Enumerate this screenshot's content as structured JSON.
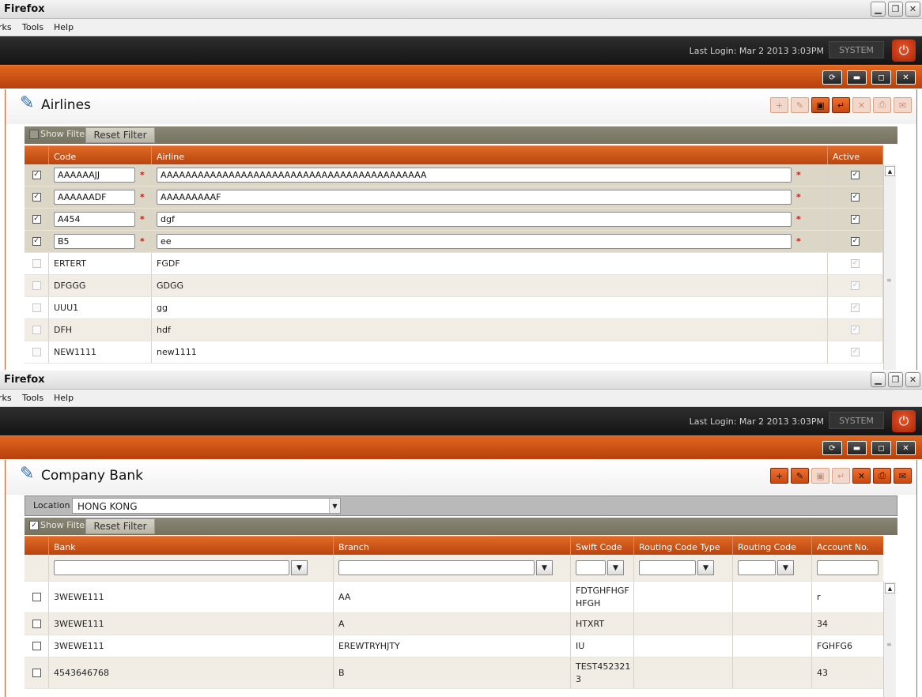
{
  "top_window": {
    "titlebar": {
      "title": "Firefox"
    },
    "menu": {
      "item1": "rks",
      "item2": "Tools",
      "item3": "Help"
    },
    "appbar": {
      "last_login": "Last Login: Mar 2 2013 3:03PM",
      "user": "SYSTEM"
    },
    "page_title": "Airlines",
    "filter": {
      "show_filter_label": "Show Filter",
      "show_filter_checked": false,
      "reset_label": "Reset Filter"
    },
    "columns": [
      "Code",
      "Airline",
      "Active"
    ],
    "edit_rows": [
      {
        "code": "AAAAAAJJ",
        "airline": "AAAAAAAAAAAAAAAAAAAAAAAAAAAAAAAAAAAAAAAAAAA",
        "active": true
      },
      {
        "code": "AAAAAADF",
        "airline": "AAAAAAAAAF",
        "active": true
      },
      {
        "code": "A454",
        "airline": "dgf",
        "active": true
      },
      {
        "code": "B5",
        "airline": "ee",
        "active": true
      }
    ],
    "rows": [
      {
        "code": "ERTERT",
        "airline": "FGDF"
      },
      {
        "code": "DFGGG",
        "airline": "GDGG"
      },
      {
        "code": "UUU1",
        "airline": "gg"
      },
      {
        "code": "DFH",
        "airline": "hdf"
      },
      {
        "code": "NEW1111",
        "airline": "new1111"
      }
    ]
  },
  "bottom_window": {
    "titlebar": {
      "title": "Firefox"
    },
    "menu": {
      "item1": "rks",
      "item2": "Tools",
      "item3": "Help"
    },
    "appbar": {
      "last_login": "Last Login: Mar 2 2013 3:03PM",
      "user": "SYSTEM"
    },
    "page_title": "Company Bank",
    "location": {
      "label": "Location",
      "value": "HONG KONG"
    },
    "filter": {
      "show_filter_label": "Show Filter",
      "show_filter_checked": true,
      "reset_label": "Reset Filter"
    },
    "columns": [
      "Bank",
      "Branch",
      "Swift Code",
      "Routing Code Type",
      "Routing Code",
      "Account No."
    ],
    "rows": [
      {
        "bank": "3WEWE111",
        "branch": "AA",
        "swift_line1": "FDTGHFHGF",
        "swift_line2": "HFGH",
        "routing_type": "",
        "routing_code": "",
        "account": "r"
      },
      {
        "bank": "3WEWE111",
        "branch": "A",
        "swift_line1": "HTXRT",
        "swift_line2": "",
        "routing_type": "",
        "routing_code": "",
        "account": "34"
      },
      {
        "bank": "3WEWE111",
        "branch": "EREWTRYHJTY",
        "swift_line1": "IU",
        "swift_line2": "",
        "routing_type": "",
        "routing_code": "",
        "account": "FGHFG6"
      },
      {
        "bank": "4543646768",
        "branch": "B",
        "swift_line1": "TEST452321",
        "swift_line2": "3",
        "routing_type": "",
        "routing_code": "",
        "account": "43"
      }
    ]
  }
}
